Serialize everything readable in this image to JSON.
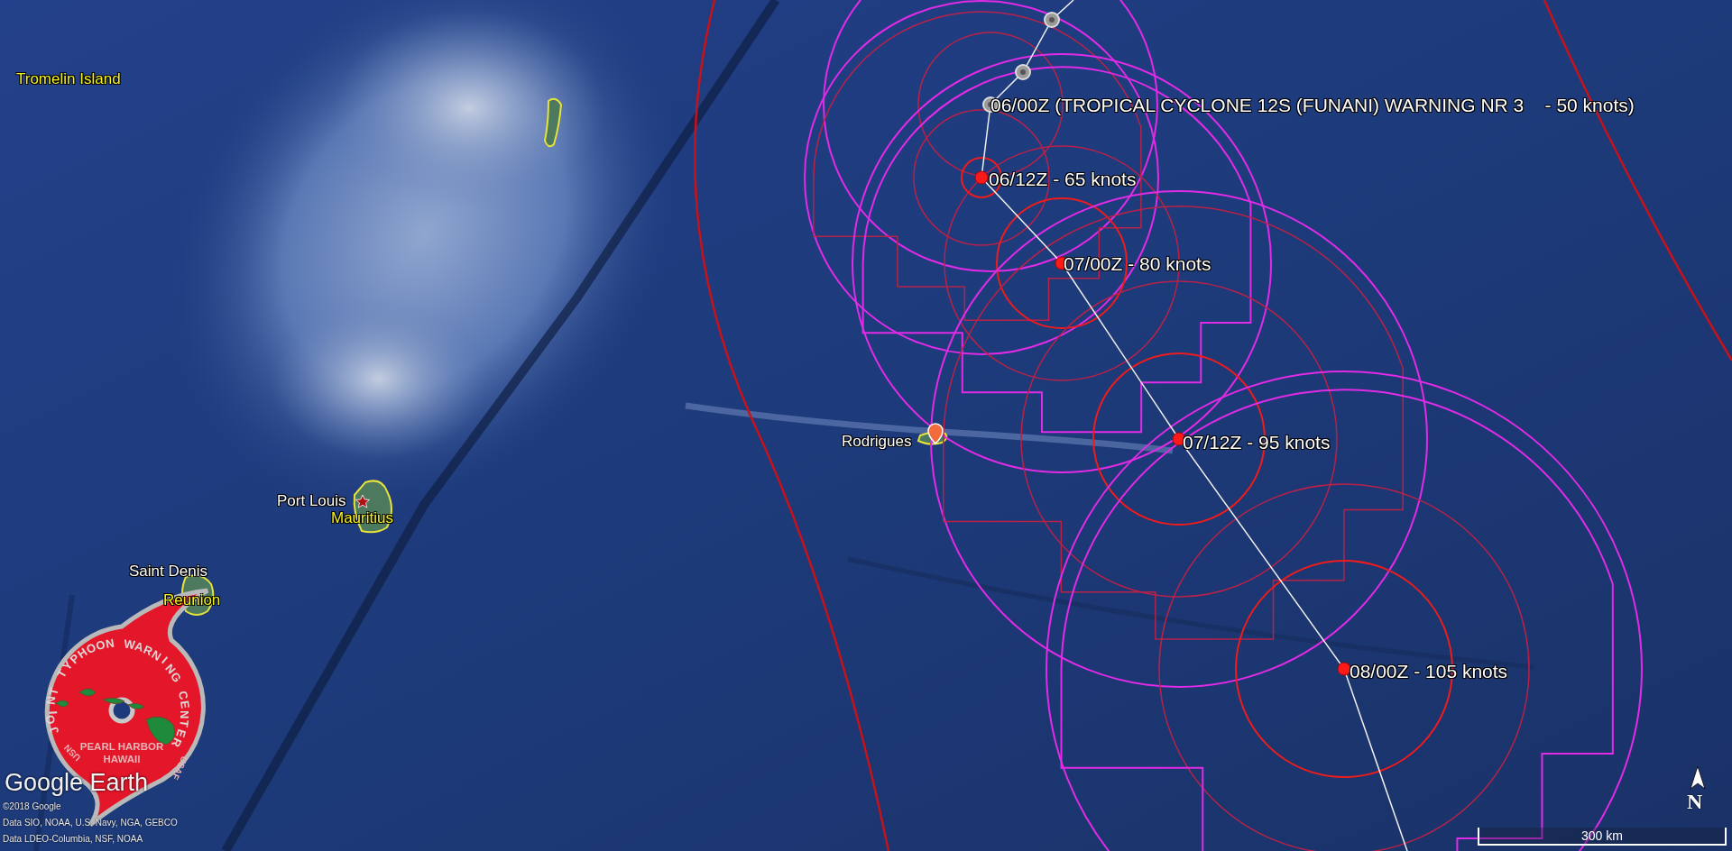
{
  "map": {
    "place_labels": [
      {
        "text": "Tromelin Island",
        "kind": "island"
      },
      {
        "text": "Rodrigues",
        "kind": "city"
      },
      {
        "text": "Port Louis",
        "kind": "city"
      },
      {
        "text": "Mauritius",
        "kind": "island"
      },
      {
        "text": "Saint Denis",
        "kind": "city"
      },
      {
        "text": "Reunion",
        "kind": "island"
      }
    ],
    "forecast": {
      "title": "06/00Z (TROPICAL CYCLONE 12S (FUNANI) WARNING NR 3    - 50 knots)",
      "points": [
        {
          "label": "06/12Z - 65 knots"
        },
        {
          "label": "07/00Z - 80 knots"
        },
        {
          "label": "07/12Z - 95 knots"
        },
        {
          "label": "08/00Z - 105 knots"
        }
      ]
    },
    "logo": {
      "arc_text": "JOINT TYPHOON WARNING CENTER",
      "line_1": "PEARL HARBOR",
      "line_2": "HAWAII",
      "left_mark": "USN",
      "right_mark": "USAF"
    },
    "brand": "Google Earth",
    "attribution": [
      "©2018 Google",
      "Data SIO, NOAA, U.S. Navy, NGA, GEBCO",
      "Data LDEO-Columbia, NSF, NOAA"
    ],
    "scale": "300 km",
    "compass": "N"
  }
}
